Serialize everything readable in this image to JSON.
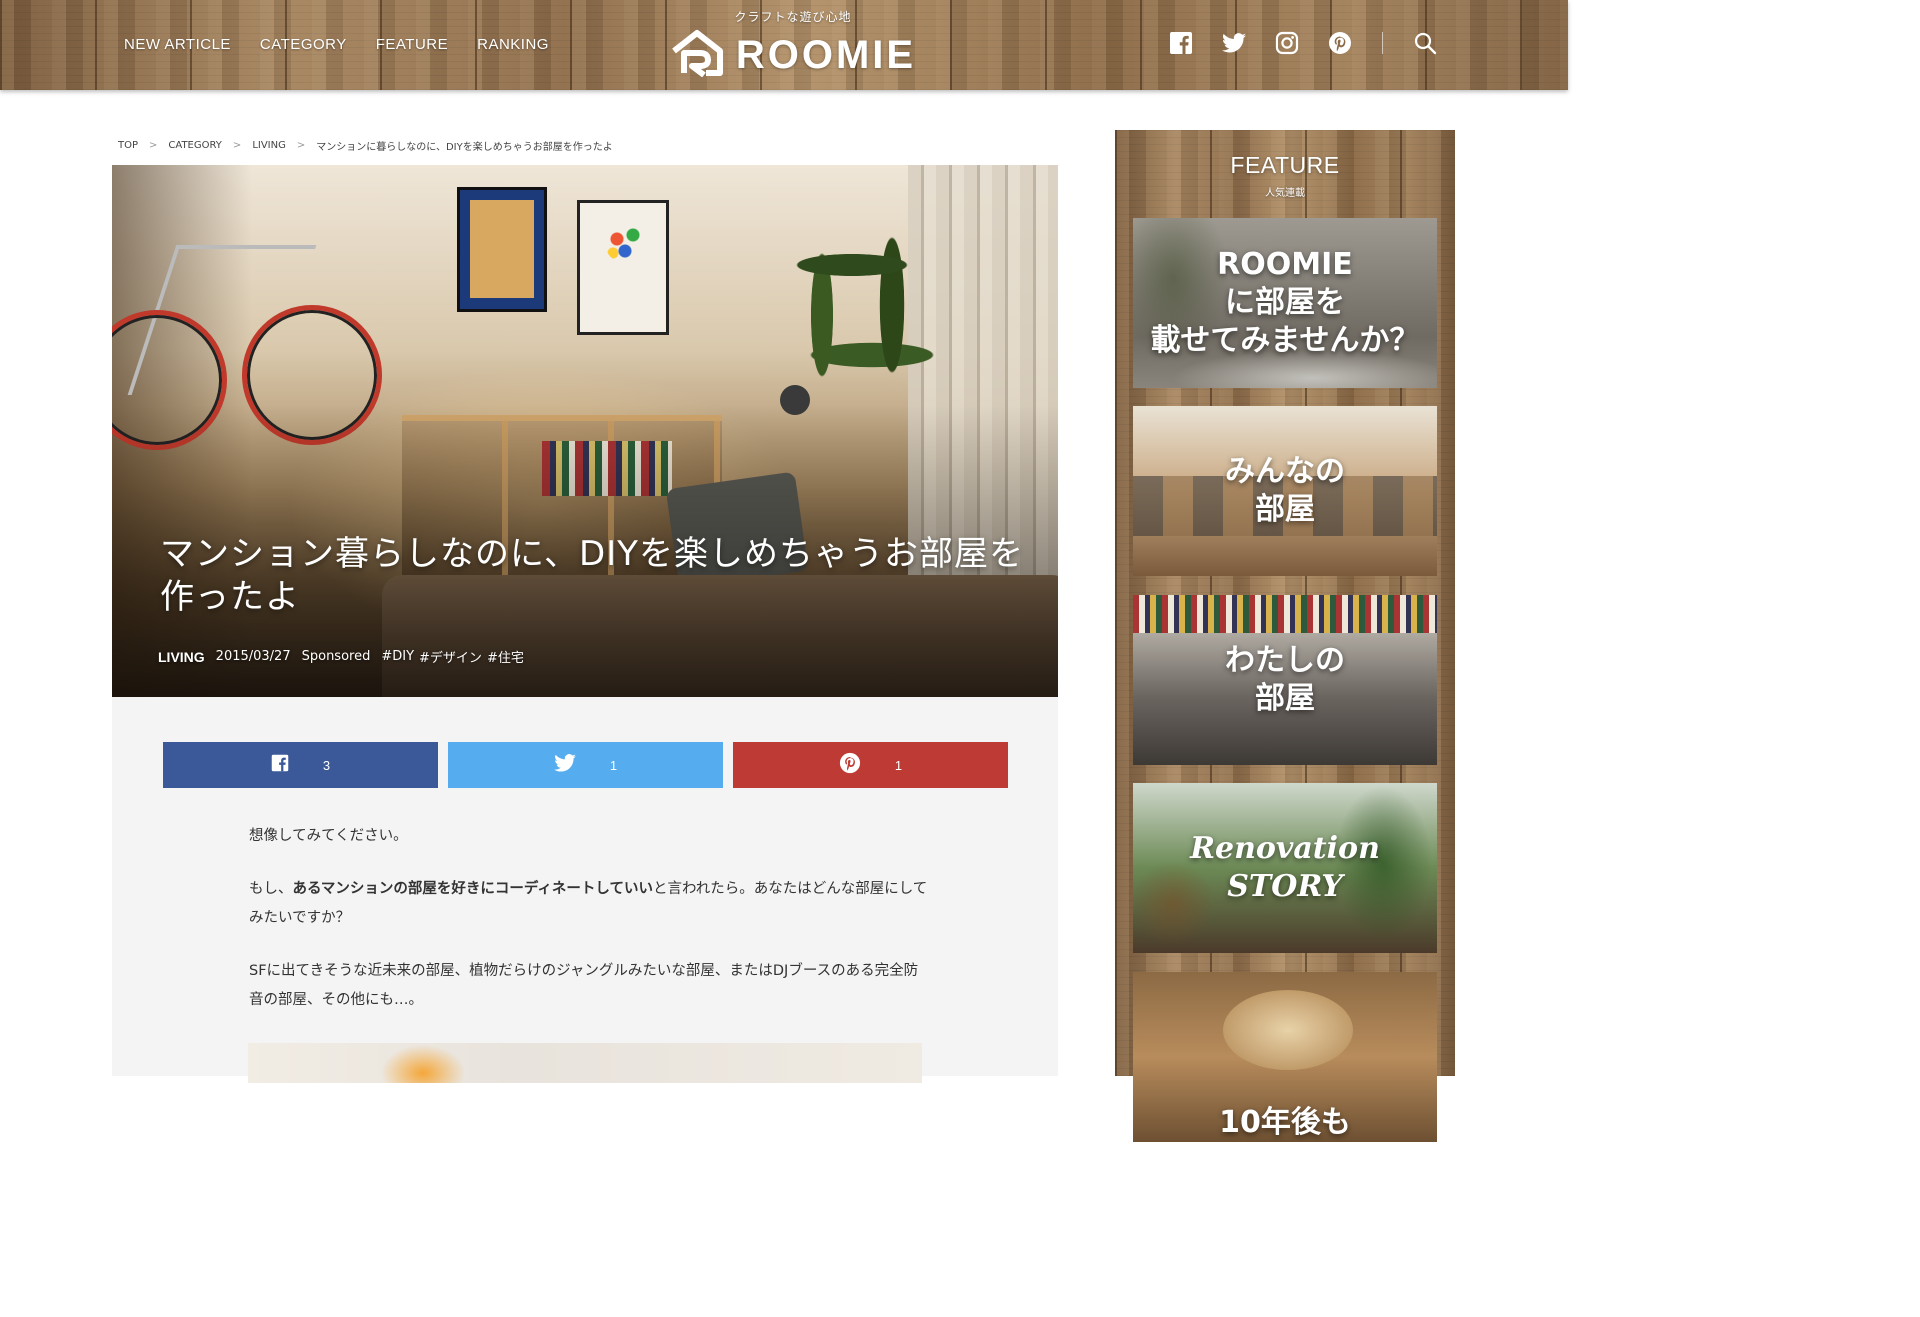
{
  "colors": {
    "facebook": "#3b5998",
    "twitter": "#55acee",
    "pinterest": "#bd3b34",
    "article_bg": "#f4f4f4"
  },
  "header": {
    "nav": [
      "NEW ARTICLE",
      "CATEGORY",
      "FEATURE",
      "RANKING"
    ],
    "logo_tagline": "クラフトな遊び心地",
    "logo_text": "ROOMIE",
    "icons": [
      "facebook-icon",
      "twitter-icon",
      "instagram-icon",
      "pinterest-icon",
      "search-icon"
    ]
  },
  "breadcrumb": {
    "items": [
      "TOP",
      "CATEGORY",
      "LIVING",
      "マンションに暮らしなのに、DIYを楽しめちゃうお部屋を作ったよ"
    ],
    "separator": ">"
  },
  "hero": {
    "title": "マンション暮らしなのに、DIYを楽しめちゃうお部屋を作ったよ",
    "category": "LIVING",
    "date": "2015/03/27",
    "sponsored": "Sponsored",
    "tags": [
      "#DIY",
      "#デザイン",
      "#住宅"
    ]
  },
  "share": {
    "facebook_count": "3",
    "twitter_count": "1",
    "pinterest_count": "1"
  },
  "article": {
    "p1": "想像してみてください。",
    "p2_prefix": "もし、",
    "p2_bold": "あるマンションの部屋を好きにコーディネートしていい",
    "p2_suffix": "と言われたら。あなたはどんな部屋にしてみたいですか？",
    "p3": "SFに出てきそうな近未来の部屋、植物だらけのジャングルみたいな部屋、またはDJブースのある完全防音の部屋、その他にも…。"
  },
  "sidebar": {
    "title": "FEATURE",
    "subtitle": "人気連載",
    "cards": [
      "ROOMIE\nに部屋を\n載せてみませんか？",
      "みんなの\n部屋",
      "わたしの\n部屋",
      "Renovation\nSTORY",
      "10年後も"
    ]
  }
}
